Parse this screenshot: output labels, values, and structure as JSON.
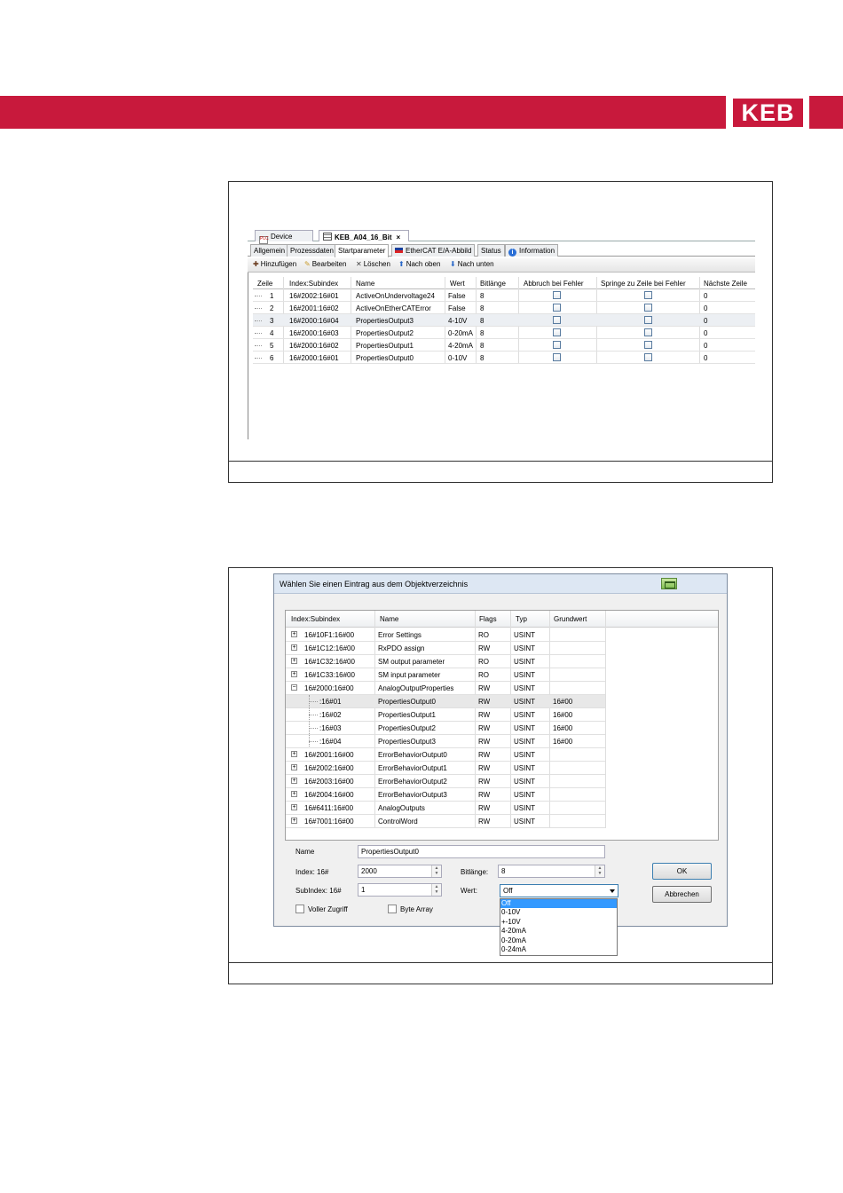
{
  "brand": {
    "logo_text": "KEB",
    "color": "#c8193c"
  },
  "figure1": {
    "doc_tabs": [
      {
        "label": "Device",
        "icon": "plc-device-icon"
      },
      {
        "label": "KEB_A04_16_Bit",
        "icon": "grid-icon",
        "close": "×"
      }
    ],
    "tabs": [
      "Allgemein",
      "Prozessdaten",
      "Startparameter",
      "EtherCAT E/A-Abbild",
      "Status",
      "Information"
    ],
    "active_tab": "Startparameter",
    "toolbar": {
      "add": "Hinzufügen",
      "edit": "Bearbeiten",
      "delete": "Löschen",
      "up": "Nach oben",
      "down": "Nach unten"
    },
    "columns": [
      "Zeile",
      "Index:Subindex",
      "Name",
      "Wert",
      "Bitlänge",
      "Abbruch bei Fehler",
      "Springe zu Zeile bei Fehler",
      "Nächste Zeile"
    ],
    "rows": [
      {
        "zeile": "1",
        "index": "16#2002:16#01",
        "name": "ActiveOnUndervoltage24",
        "wert": "False",
        "bit": "8",
        "next": "0"
      },
      {
        "zeile": "2",
        "index": "16#2001:16#02",
        "name": "ActiveOnEtherCATError",
        "wert": "False",
        "bit": "8",
        "next": "0"
      },
      {
        "zeile": "3",
        "index": "16#2000:16#04",
        "name": "PropertiesOutput3",
        "wert": "4-10V",
        "bit": "8",
        "next": "0"
      },
      {
        "zeile": "4",
        "index": "16#2000:16#03",
        "name": "PropertiesOutput2",
        "wert": "0-20mA",
        "bit": "8",
        "next": "0"
      },
      {
        "zeile": "5",
        "index": "16#2000:16#02",
        "name": "PropertiesOutput1",
        "wert": "4-20mA",
        "bit": "8",
        "next": "0"
      },
      {
        "zeile": "6",
        "index": "16#2000:16#01",
        "name": "PropertiesOutput0",
        "wert": "0-10V",
        "bit": "8",
        "next": "0"
      }
    ]
  },
  "figure2": {
    "title": "Wählen Sie einen Eintrag aus dem Objektverzeichnis",
    "columns": [
      "Index:Subindex",
      "Name",
      "Flags",
      "Typ",
      "Grundwert"
    ],
    "rows": [
      {
        "index": "16#10F1:16#00",
        "name": "Error Settings",
        "flags": "RO",
        "typ": "USINT",
        "grund": "",
        "expander": "+",
        "level": 0
      },
      {
        "index": "16#1C12:16#00",
        "name": "RxPDO assign",
        "flags": "RW",
        "typ": "USINT",
        "grund": "",
        "expander": "+",
        "level": 0
      },
      {
        "index": "16#1C32:16#00",
        "name": "SM output parameter",
        "flags": "RO",
        "typ": "USINT",
        "grund": "",
        "expander": "+",
        "level": 0
      },
      {
        "index": "16#1C33:16#00",
        "name": "SM input parameter",
        "flags": "RO",
        "typ": "USINT",
        "grund": "",
        "expander": "+",
        "level": 0
      },
      {
        "index": "16#2000:16#00",
        "name": "AnalogOutputProperties",
        "flags": "RW",
        "typ": "USINT",
        "grund": "",
        "expander": "−",
        "level": 0
      },
      {
        "index": ":16#01",
        "name": "PropertiesOutput0",
        "flags": "RW",
        "typ": "USINT",
        "grund": "16#00",
        "expander": "",
        "level": 1
      },
      {
        "index": ":16#02",
        "name": "PropertiesOutput1",
        "flags": "RW",
        "typ": "USINT",
        "grund": "16#00",
        "expander": "",
        "level": 1
      },
      {
        "index": ":16#03",
        "name": "PropertiesOutput2",
        "flags": "RW",
        "typ": "USINT",
        "grund": "16#00",
        "expander": "",
        "level": 1
      },
      {
        "index": ":16#04",
        "name": "PropertiesOutput3",
        "flags": "RW",
        "typ": "USINT",
        "grund": "16#00",
        "expander": "",
        "level": 1
      },
      {
        "index": "16#2001:16#00",
        "name": "ErrorBehaviorOutput0",
        "flags": "RW",
        "typ": "USINT",
        "grund": "",
        "expander": "+",
        "level": 0
      },
      {
        "index": "16#2002:16#00",
        "name": "ErrorBehaviorOutput1",
        "flags": "RW",
        "typ": "USINT",
        "grund": "",
        "expander": "+",
        "level": 0
      },
      {
        "index": "16#2003:16#00",
        "name": "ErrorBehaviorOutput2",
        "flags": "RW",
        "typ": "USINT",
        "grund": "",
        "expander": "+",
        "level": 0
      },
      {
        "index": "16#2004:16#00",
        "name": "ErrorBehaviorOutput3",
        "flags": "RW",
        "typ": "USINT",
        "grund": "",
        "expander": "+",
        "level": 0
      },
      {
        "index": "16#6411:16#00",
        "name": "AnalogOutputs",
        "flags": "RW",
        "typ": "USINT",
        "grund": "",
        "expander": "+",
        "level": 0
      },
      {
        "index": "16#7001:16#00",
        "name": "ControlWord",
        "flags": "RW",
        "typ": "USINT",
        "grund": "",
        "expander": "+",
        "level": 0
      }
    ],
    "form": {
      "name_label": "Name",
      "name_value": "PropertiesOutput0",
      "index_label": "Index: 16#",
      "index_value": "2000",
      "subindex_label": "SubIndex: 16#",
      "subindex_value": "1",
      "bitlen_label": "Bitlänge:",
      "bitlen_value": "8",
      "wert_label": "Wert:",
      "wert_value": "Off",
      "full_access": "Voller Zugriff",
      "byte_array": "Byte Array",
      "ok": "OK",
      "cancel": "Abbrechen"
    },
    "wert_options": [
      "Off",
      "0-10V",
      "+-10V",
      "4-20mA",
      "0-20mA",
      "0-24mA"
    ]
  }
}
